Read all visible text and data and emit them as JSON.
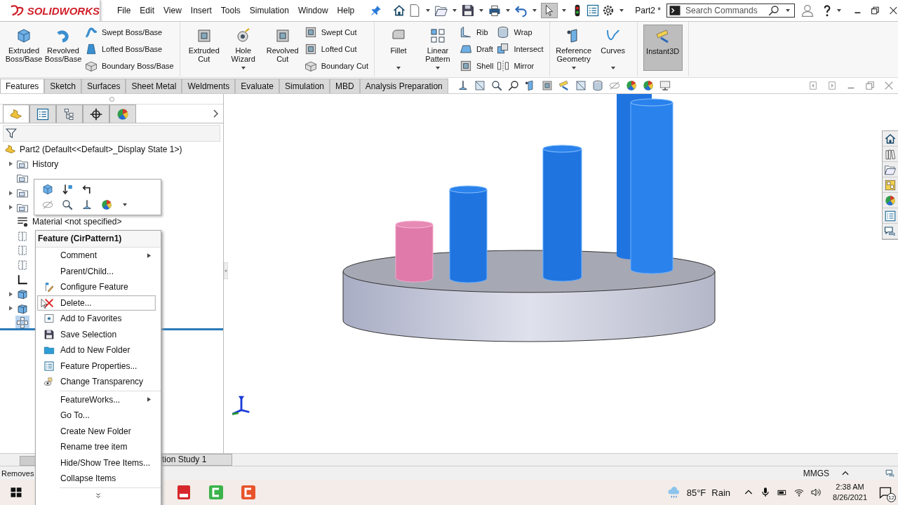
{
  "app": {
    "logo": "SOLIDWORKS",
    "document_title": "Part2 *"
  },
  "menu": [
    "File",
    "Edit",
    "View",
    "Insert",
    "Tools",
    "Simulation",
    "Window",
    "Help"
  ],
  "search": {
    "placeholder": "Search Commands"
  },
  "ribbon": [
    {
      "items": [
        {
          "kind": "large",
          "label": "Extruded Boss/Base",
          "dropdown": false,
          "selected": false
        },
        {
          "kind": "large",
          "label": "Revolved Boss/Base",
          "dropdown": false,
          "selected": false
        },
        {
          "kind": "stack",
          "items": [
            "Swept Boss/Base",
            "Lofted Boss/Base",
            "Boundary Boss/Base"
          ]
        }
      ]
    },
    {
      "items": [
        {
          "kind": "large",
          "label": "Extruded Cut",
          "dropdown": false,
          "selected": false
        },
        {
          "kind": "large",
          "label": "Hole Wizard",
          "dropdown": true,
          "selected": false
        },
        {
          "kind": "large",
          "label": "Revolved Cut",
          "dropdown": false,
          "selected": false
        },
        {
          "kind": "stack",
          "items": [
            "Swept Cut",
            "Lofted Cut",
            "Boundary Cut"
          ]
        }
      ]
    },
    {
      "items": [
        {
          "kind": "large",
          "label": "Fillet",
          "dropdown": true,
          "selected": false
        },
        {
          "kind": "large",
          "label": "Linear Pattern",
          "dropdown": true,
          "selected": false
        },
        {
          "kind": "stack",
          "items": [
            "Rib",
            "Draft",
            "Shell"
          ]
        },
        {
          "kind": "stack",
          "items": [
            "Wrap",
            "Intersect",
            "Mirror"
          ]
        }
      ]
    },
    {
      "items": [
        {
          "kind": "large",
          "label": "Reference Geometry",
          "dropdown": true,
          "selected": false
        },
        {
          "kind": "large",
          "label": "Curves",
          "dropdown": true,
          "selected": false
        }
      ]
    },
    {
      "items": [
        {
          "kind": "large",
          "label": "Instant3D",
          "dropdown": false,
          "selected": true
        }
      ]
    }
  ],
  "tabs": [
    {
      "label": "Features",
      "selected": true
    },
    {
      "label": "Sketch",
      "selected": false
    },
    {
      "label": "Surfaces",
      "selected": false
    },
    {
      "label": "Sheet Metal",
      "selected": false
    },
    {
      "label": "Weldments",
      "selected": false
    },
    {
      "label": "Evaluate",
      "selected": false
    },
    {
      "label": "Simulation",
      "selected": false
    },
    {
      "label": "MBD",
      "selected": false
    },
    {
      "label": "Analysis Preparation",
      "selected": false
    }
  ],
  "panel_tabs": [
    {
      "selected": true
    },
    {
      "selected": false
    },
    {
      "selected": false
    },
    {
      "selected": false
    },
    {
      "selected": false
    }
  ],
  "tree": {
    "root": "Part2  (Default<<Default>_Display State 1>)",
    "items": [
      {
        "label": "History",
        "has_children": true,
        "selected": false
      },
      {
        "has_children": false,
        "selected": false
      },
      {
        "has_children": true,
        "selected": false
      },
      {
        "has_children": true,
        "selected": false
      },
      {
        "label": "Material <not specified>",
        "has_children": false,
        "selected": false
      },
      {
        "has_children": false,
        "selected": false
      },
      {
        "has_children": false,
        "selected": false
      },
      {
        "has_children": false,
        "selected": false
      },
      {
        "has_children": false,
        "selected": false
      },
      {
        "has_children": true,
        "selected": false
      },
      {
        "has_children": true,
        "selected": false
      },
      {
        "has_children": false,
        "selected": true
      }
    ]
  },
  "context_menu": {
    "title": "Feature (CirPattern1)",
    "items": [
      {
        "kind": "item",
        "label": "Comment",
        "submenu": true,
        "selected": false
      },
      {
        "kind": "item",
        "label": "Parent/Child...",
        "submenu": false,
        "selected": false
      },
      {
        "kind": "item",
        "label": "Configure Feature",
        "submenu": false,
        "selected": false
      },
      {
        "kind": "item",
        "label": "Delete...",
        "submenu": false,
        "selected": true
      },
      {
        "kind": "item",
        "label": "Add to Favorites",
        "submenu": false,
        "selected": false
      },
      {
        "kind": "item",
        "label": "Save Selection",
        "submenu": false,
        "selected": false
      },
      {
        "kind": "item",
        "label": "Add to New Folder",
        "submenu": false,
        "selected": false
      },
      {
        "kind": "item",
        "label": "Feature Properties...",
        "submenu": false,
        "selected": false
      },
      {
        "kind": "item",
        "label": "Change Transparency",
        "submenu": false,
        "selected": false
      },
      {
        "kind": "separator"
      },
      {
        "kind": "item",
        "label": "FeatureWorks...",
        "submenu": true,
        "selected": false
      },
      {
        "kind": "item",
        "label": "Go To...",
        "submenu": false,
        "selected": false
      },
      {
        "kind": "item",
        "label": "Create New Folder",
        "submenu": false,
        "selected": false
      },
      {
        "kind": "item",
        "label": "Rename tree item",
        "submenu": false,
        "selected": false
      },
      {
        "kind": "item",
        "label": "Hide/Show Tree Items...",
        "submenu": false,
        "selected": false
      },
      {
        "kind": "item",
        "label": "Collapse Items",
        "submenu": false,
        "selected": false
      },
      {
        "kind": "separator"
      },
      {
        "kind": "more"
      }
    ]
  },
  "bottom_tabs": [
    "tion Study 1"
  ],
  "status_bar": {
    "message": "Removes",
    "units": "MMGS"
  },
  "taskbar": {
    "temperature": "85°F",
    "weather": "Rain",
    "time": "2:38 AM",
    "date": "8/26/2021",
    "notifications": "12"
  }
}
